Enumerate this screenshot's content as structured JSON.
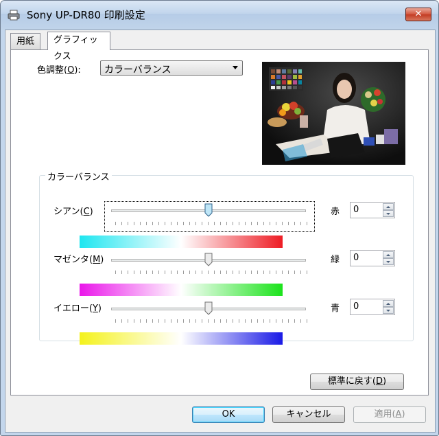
{
  "window": {
    "title": "Sony UP-DR80 印刷設定",
    "close_label": "✕"
  },
  "tabs": [
    {
      "label": "用紙"
    },
    {
      "label": "グラフィックス"
    }
  ],
  "color_adjust": {
    "label_prefix": "色調整(",
    "label_key": "O",
    "label_suffix": "):",
    "selected": "カラーバランス"
  },
  "color_balance": {
    "group_title": "カラーバランス",
    "rows": [
      {
        "label_prefix": "シアン(",
        "label_key": "C",
        "label_suffix": ")",
        "right_label": "赤",
        "value": "0",
        "slider_level": 0.5,
        "gradient": [
          "#1ee6f0",
          "#ffffff",
          "#ee1c24"
        ]
      },
      {
        "label_prefix": "マゼンタ(",
        "label_key": "M",
        "label_suffix": ")",
        "right_label": "緑",
        "value": "0",
        "slider_level": 0.5,
        "gradient": [
          "#ea16ea",
          "#ffffff",
          "#1be31b"
        ]
      },
      {
        "label_prefix": "イエロー(",
        "label_key": "Y",
        "label_suffix": ")",
        "right_label": "青",
        "value": "0",
        "slider_level": 0.5,
        "gradient": [
          "#f4f21c",
          "#ffffff",
          "#1a1ae6"
        ]
      }
    ]
  },
  "buttons": {
    "reset_prefix": "標準に戻す(",
    "reset_key": "D",
    "reset_suffix": ")",
    "ok": "OK",
    "cancel": "キャンセル",
    "apply_prefix": "適用(",
    "apply_key": "A",
    "apply_suffix": ")"
  },
  "icons": {
    "title": "printer-icon",
    "spin_up": "arrow-up-icon",
    "spin_down": "arrow-down-icon",
    "combo": "chevron-down-icon"
  }
}
